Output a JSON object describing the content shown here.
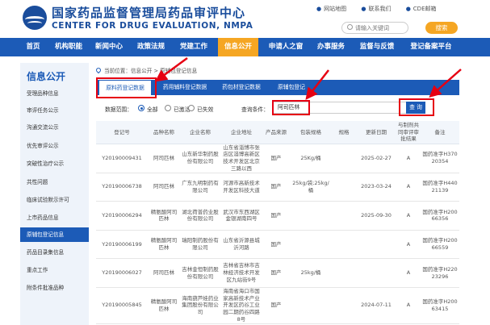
{
  "header": {
    "title": "国家药品监督管理局药品审评中心",
    "subtitle": "CENTER FOR DRUG EVALUATION, NMPA",
    "top_links": [
      "网站地图",
      "联系我们",
      "CDE邮箱"
    ],
    "search_placeholder": "请输入关键词",
    "search_button": "搜索"
  },
  "nav": {
    "items": [
      "首页",
      "机构职能",
      "新闻中心",
      "政策法规",
      "党建工作",
      "信息公开",
      "申请人之窗",
      "办事服务",
      "监督与反馈",
      "登记备案平台"
    ],
    "active": "信息公开"
  },
  "sidebar": {
    "title": "信息公开",
    "items": [
      "受理品种信息",
      "审评任务公示",
      "沟通交流公示",
      "优先审评公示",
      "突破性治疗公示",
      "共性问题",
      "临床试验默示许可",
      "上市药品信息",
      "原辅包登记信息",
      "药品目录集信息",
      "重点工作",
      "附条件批准品种"
    ],
    "active": "原辅包登记信息"
  },
  "breadcrumb": "当前位置：信息公开 > 原辅包登记信息",
  "tabs": {
    "items": [
      "原料药登记数据",
      "药用辅料登记数据",
      "药包材登记数据",
      "原辅包登记"
    ],
    "active": "原料药登记数据"
  },
  "filter": {
    "range_label": "数据范围：",
    "options": [
      "全部",
      "已激活",
      "已失效"
    ],
    "selected": "全部",
    "cond_label": "查询条件：",
    "cond_value": "阿司匹林",
    "query_button": "查 询"
  },
  "table": {
    "headers": [
      "登记号",
      "品种名称",
      "企业名称",
      "企业地址",
      "产品来源",
      "包装规格",
      "规格",
      "更新日期",
      "与制剂共同审评审批结果",
      "备注"
    ],
    "rows": [
      [
        "Y20190009431",
        "阿司匹林",
        "山东新华制药股份有限公司",
        "山东省淄博市张店区淄博高新区技术开发区北京三路以西",
        "国产",
        "25Kg/桶",
        "",
        "2025-02-27",
        "A",
        "国药准字H37020354"
      ],
      [
        "Y20190006738",
        "阿司匹林",
        "广东九明制药有限公司",
        "河源市高新技术开发区科技大道",
        "国产",
        "25kg/袋;25kg/桶",
        "",
        "2023-03-24",
        "A",
        "国药准字H44021139"
      ],
      [
        "Y20190006294",
        "精氨酸阿司匹林",
        "湖北荷普药业股份有限公司",
        "武汉市东西湖区金银湖南四号",
        "国产",
        "",
        "",
        "2025-09-30",
        "A",
        "国药准字H20066356"
      ],
      [
        "Y20190006199",
        "精氨酸阿司匹林",
        "瑞阳制药股份有限公司",
        "山东省沂源县城沂河路",
        "国产",
        "",
        "",
        "",
        "A",
        "国药准字H20066559"
      ],
      [
        "Y20190006027",
        "阿司匹林",
        "吉林金恒制药股份有限公司",
        "吉林省吉林市吉林经济技术开发区九站街9号",
        "国产",
        "25kg/桶",
        "",
        "",
        "A",
        "国药准字H22023296"
      ],
      [
        "Y20190005845",
        "精氨酸阿司匹林",
        "海南葫芦娃药业集团股份有限公司",
        "海南省海口市国家高新技术产业开发区药谷工业园二期药谷四路8号",
        "国产",
        "",
        "",
        "2024-07-11",
        "A",
        "国药准字H20063415"
      ]
    ]
  }
}
